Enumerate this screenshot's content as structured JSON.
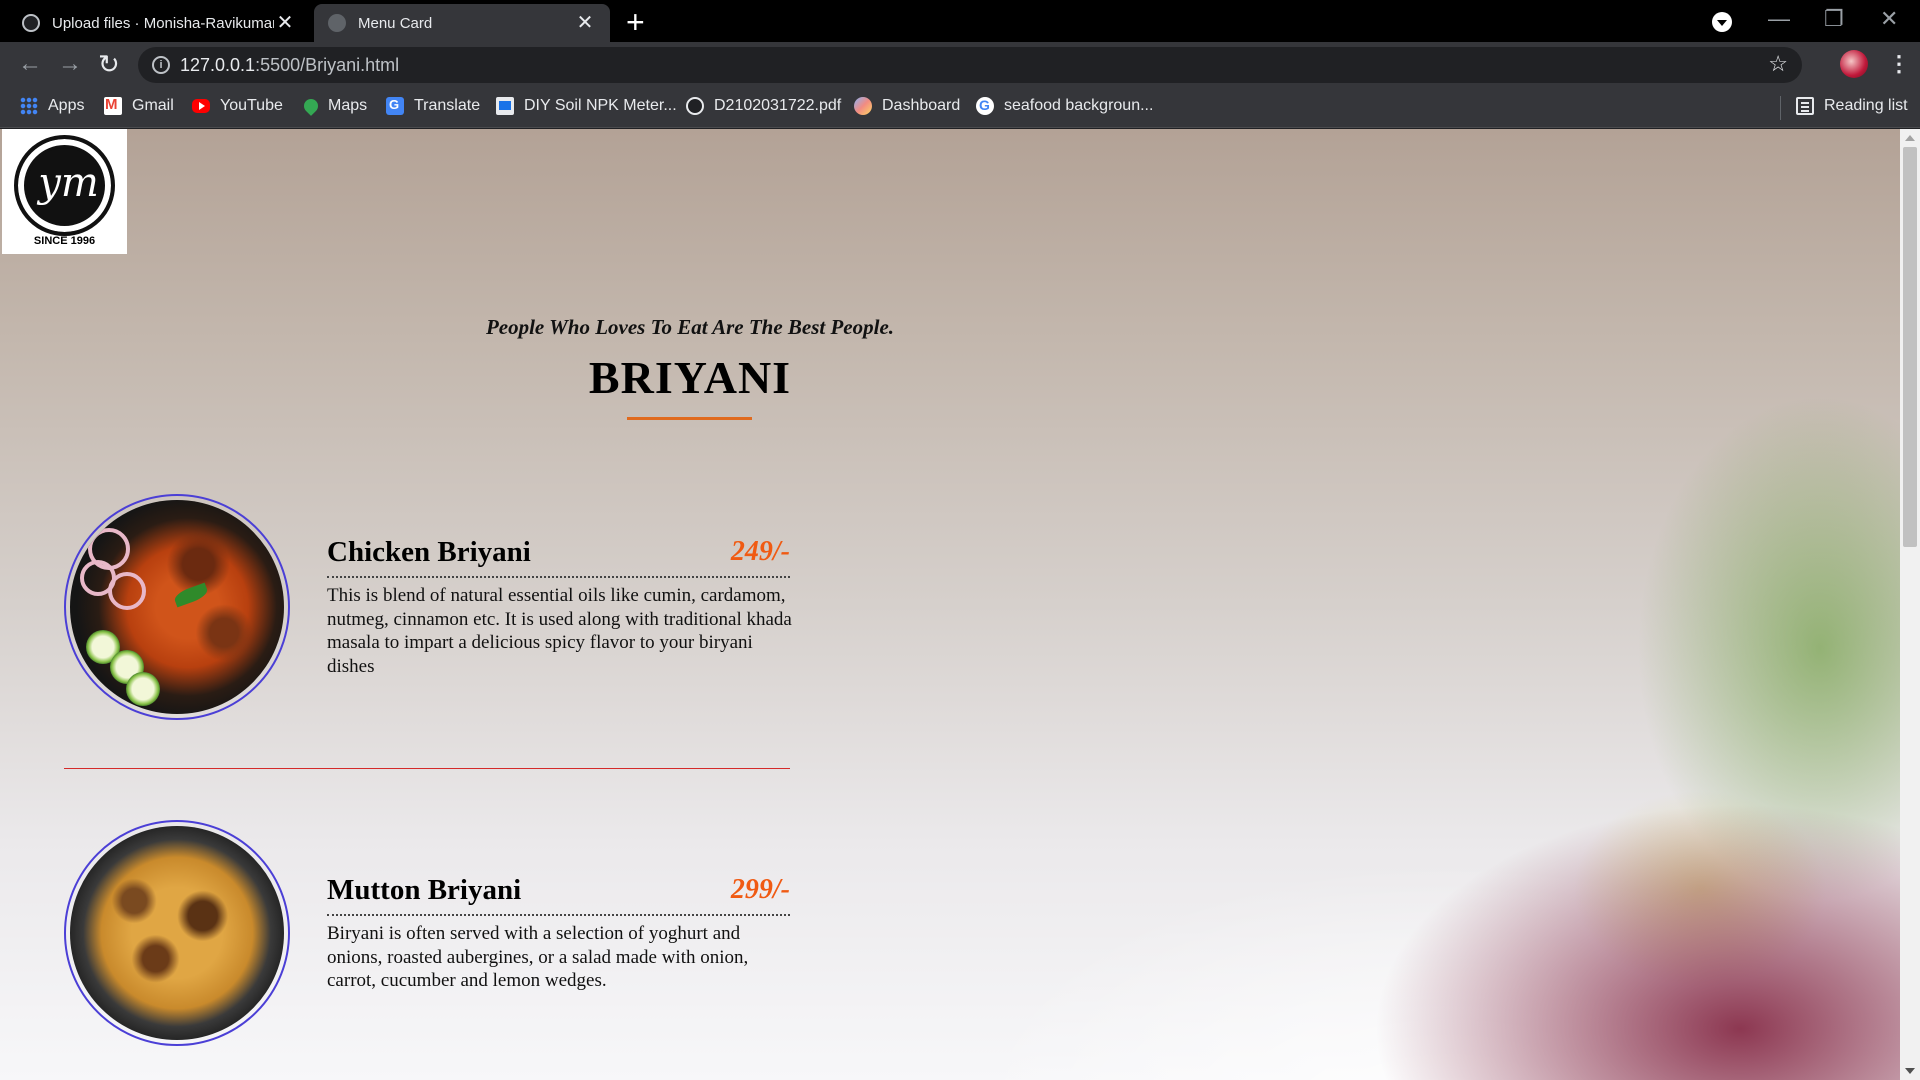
{
  "browser": {
    "tabs": [
      {
        "title": "Upload files · Monisha-Ravikumar",
        "close": "✕"
      },
      {
        "title": "Menu Card",
        "close": "✕"
      }
    ],
    "new_tab": "+",
    "window_controls": {
      "minimize": "—",
      "restore": "❐",
      "close": "✕"
    },
    "nav": {
      "back": "←",
      "forward": "→",
      "reload": "↻"
    },
    "address": {
      "host": "127.0.0.1",
      "path": ":5500/Briyani.html",
      "info": "i"
    },
    "star": "☆",
    "menu": "⋮",
    "bookmarks": [
      {
        "label": "Apps",
        "icon": "apps-icon"
      },
      {
        "label": "Gmail",
        "icon": "gmail-icon"
      },
      {
        "label": "YouTube",
        "icon": "youtube-icon"
      },
      {
        "label": "Maps",
        "icon": "maps-icon"
      },
      {
        "label": "Translate",
        "icon": "translate-icon"
      },
      {
        "label": "DIY Soil NPK Meter...",
        "icon": "document-icon"
      },
      {
        "label": "D2102031722.pdf",
        "icon": "globe-icon"
      },
      {
        "label": "Dashboard",
        "icon": "dashboard-icon"
      },
      {
        "label": "seafood backgroun...",
        "icon": "google-icon"
      }
    ],
    "reading_list": "Reading list"
  },
  "page": {
    "logo": {
      "monogram": "ym",
      "since": "SINCE 1996"
    },
    "tagline": "People Who Loves To Eat Are The Best People.",
    "title": "BRIYANI",
    "items": [
      {
        "name": "Chicken Briyani",
        "price": "249/-",
        "description": "This is blend of natural essential oils like cumin, cardamom, nutmeg, cinnamon etc. It is used along with traditional khada masala to impart a delicious spicy flavor to your biryani dishes"
      },
      {
        "name": "Mutton Briyani",
        "price": "299/-",
        "description": "Biryani is often served with a selection of yoghurt and onions, roasted aubergines, or a salad made with onion, carrot, cucumber and lemon wedges."
      }
    ]
  },
  "colors": {
    "accent_orange": "#f05a12",
    "heading_rule": "#e06a1e",
    "divider_red": "#d42a2a",
    "image_border": "#4b3fd6"
  }
}
